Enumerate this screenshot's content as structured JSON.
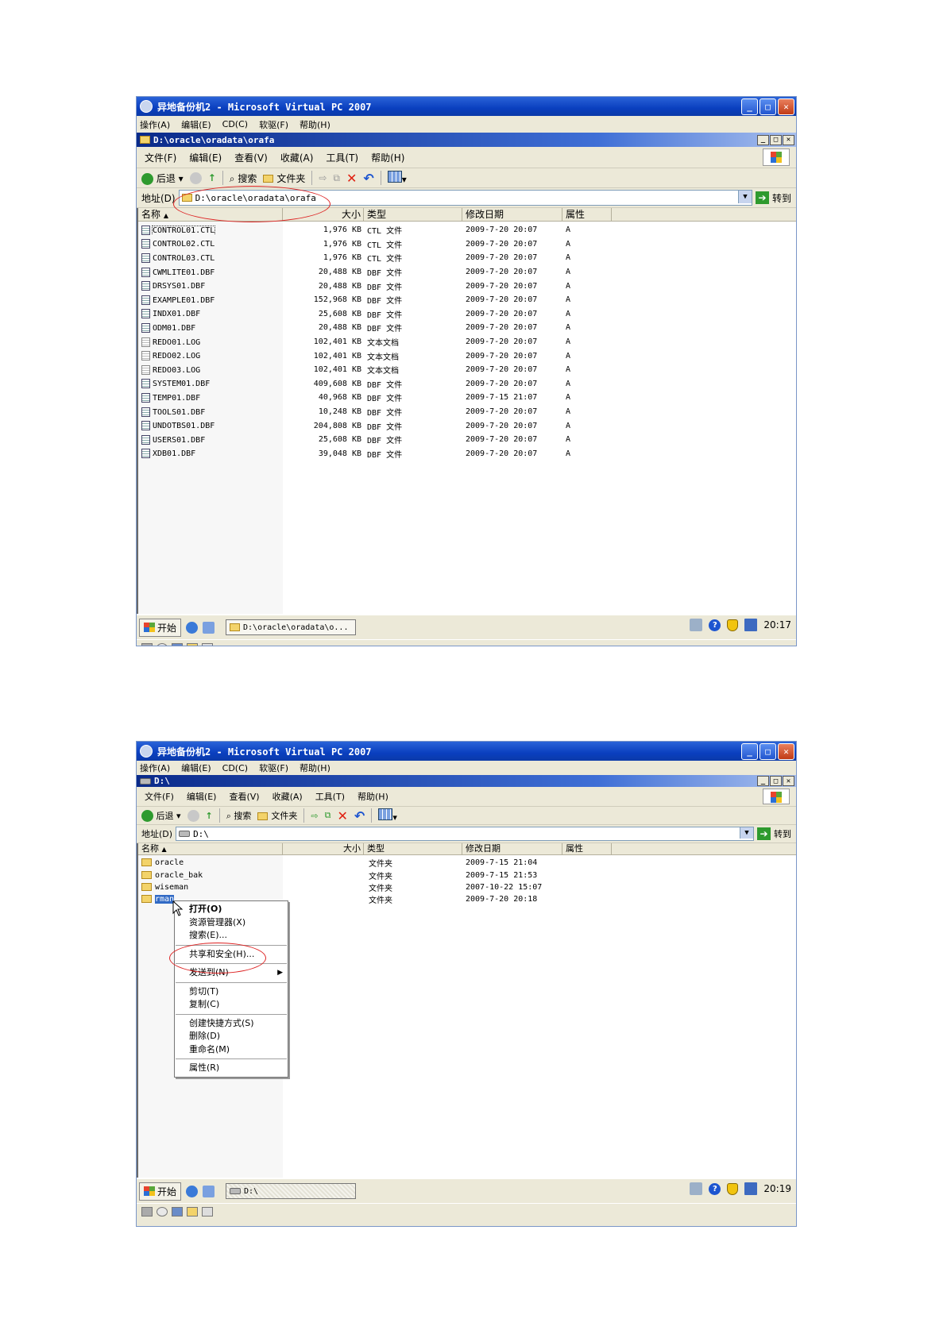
{
  "vpc": {
    "title": "异地备份机2 - Microsoft Virtual PC 2007",
    "menu": [
      "操作(A)",
      "编辑(E)",
      "CD(C)",
      "软驱(F)",
      "帮助(H)"
    ],
    "min_glyph": "_",
    "max_glyph": "□",
    "close_glyph": "✕"
  },
  "explorer": {
    "menu": [
      "文件(F)",
      "编辑(E)",
      "查看(V)",
      "收藏(A)",
      "工具(T)",
      "帮助(H)"
    ],
    "back_label": "后退",
    "search_label": "搜索",
    "folders_label": "文件夹",
    "address_label": "地址(D)",
    "go_label": "转到",
    "columns": [
      "名称",
      "大小",
      "类型",
      "修改日期",
      "属性"
    ]
  },
  "shot1": {
    "window_title": "D:\\oracle\\oradata\\orafa",
    "address": "D:\\oracle\\oradata\\orafa",
    "files": [
      {
        "name": "CONTROL01.CTL",
        "size": "1,976 KB",
        "type": "CTL 文件",
        "date": "2009-7-20 20:07",
        "attr": "A",
        "kind": "db"
      },
      {
        "name": "CONTROL02.CTL",
        "size": "1,976 KB",
        "type": "CTL 文件",
        "date": "2009-7-20 20:07",
        "attr": "A",
        "kind": "db"
      },
      {
        "name": "CONTROL03.CTL",
        "size": "1,976 KB",
        "type": "CTL 文件",
        "date": "2009-7-20 20:07",
        "attr": "A",
        "kind": "db"
      },
      {
        "name": "CWMLITE01.DBF",
        "size": "20,488 KB",
        "type": "DBF 文件",
        "date": "2009-7-20 20:07",
        "attr": "A",
        "kind": "db"
      },
      {
        "name": "DRSYS01.DBF",
        "size": "20,488 KB",
        "type": "DBF 文件",
        "date": "2009-7-20 20:07",
        "attr": "A",
        "kind": "db"
      },
      {
        "name": "EXAMPLE01.DBF",
        "size": "152,968 KB",
        "type": "DBF 文件",
        "date": "2009-7-20 20:07",
        "attr": "A",
        "kind": "db"
      },
      {
        "name": "INDX01.DBF",
        "size": "25,608 KB",
        "type": "DBF 文件",
        "date": "2009-7-20 20:07",
        "attr": "A",
        "kind": "db"
      },
      {
        "name": "ODM01.DBF",
        "size": "20,488 KB",
        "type": "DBF 文件",
        "date": "2009-7-20 20:07",
        "attr": "A",
        "kind": "db"
      },
      {
        "name": "REDO01.LOG",
        "size": "102,401 KB",
        "type": "文本文档",
        "date": "2009-7-20 20:07",
        "attr": "A",
        "kind": "txt"
      },
      {
        "name": "REDO02.LOG",
        "size": "102,401 KB",
        "type": "文本文档",
        "date": "2009-7-20 20:07",
        "attr": "A",
        "kind": "txt"
      },
      {
        "name": "REDO03.LOG",
        "size": "102,401 KB",
        "type": "文本文档",
        "date": "2009-7-20 20:07",
        "attr": "A",
        "kind": "txt"
      },
      {
        "name": "SYSTEM01.DBF",
        "size": "409,608 KB",
        "type": "DBF 文件",
        "date": "2009-7-20 20:07",
        "attr": "A",
        "kind": "db"
      },
      {
        "name": "TEMP01.DBF",
        "size": "40,968 KB",
        "type": "DBF 文件",
        "date": "2009-7-15 21:07",
        "attr": "A",
        "kind": "db"
      },
      {
        "name": "TOOLS01.DBF",
        "size": "10,248 KB",
        "type": "DBF 文件",
        "date": "2009-7-20 20:07",
        "attr": "A",
        "kind": "db"
      },
      {
        "name": "UNDOTBS01.DBF",
        "size": "204,808 KB",
        "type": "DBF 文件",
        "date": "2009-7-20 20:07",
        "attr": "A",
        "kind": "db"
      },
      {
        "name": "USERS01.DBF",
        "size": "25,608 KB",
        "type": "DBF 文件",
        "date": "2009-7-20 20:07",
        "attr": "A",
        "kind": "db"
      },
      {
        "name": "XDB01.DBF",
        "size": "39,048 KB",
        "type": "DBF 文件",
        "date": "2009-7-20 20:07",
        "attr": "A",
        "kind": "db"
      }
    ],
    "start_label": "开始",
    "task_label": "D:\\oracle\\oradata\\o...",
    "clock": "20:17"
  },
  "shot2": {
    "window_title": "D:\\",
    "address": "D:\\",
    "folders": [
      {
        "name": "oracle",
        "type": "文件夹",
        "date": "2009-7-15 21:04"
      },
      {
        "name": "oracle_bak",
        "type": "文件夹",
        "date": "2009-7-15 21:53"
      },
      {
        "name": "wiseman",
        "type": "文件夹",
        "date": "2007-10-22 15:07"
      },
      {
        "name": "rman",
        "type": "文件夹",
        "date": "2009-7-20 20:18"
      }
    ],
    "context_menu": {
      "open": "打开(O)",
      "explorer": "资源管理器(X)",
      "search": "搜索(E)...",
      "share": "共享和安全(H)...",
      "send_to": "发送到(N)",
      "cut": "剪切(T)",
      "copy": "复制(C)",
      "shortcut": "创建快捷方式(S)",
      "delete": "删除(D)",
      "rename": "重命名(M)",
      "properties": "属性(R)"
    },
    "start_label": "开始",
    "task_label": "D:\\",
    "clock": "20:19"
  }
}
